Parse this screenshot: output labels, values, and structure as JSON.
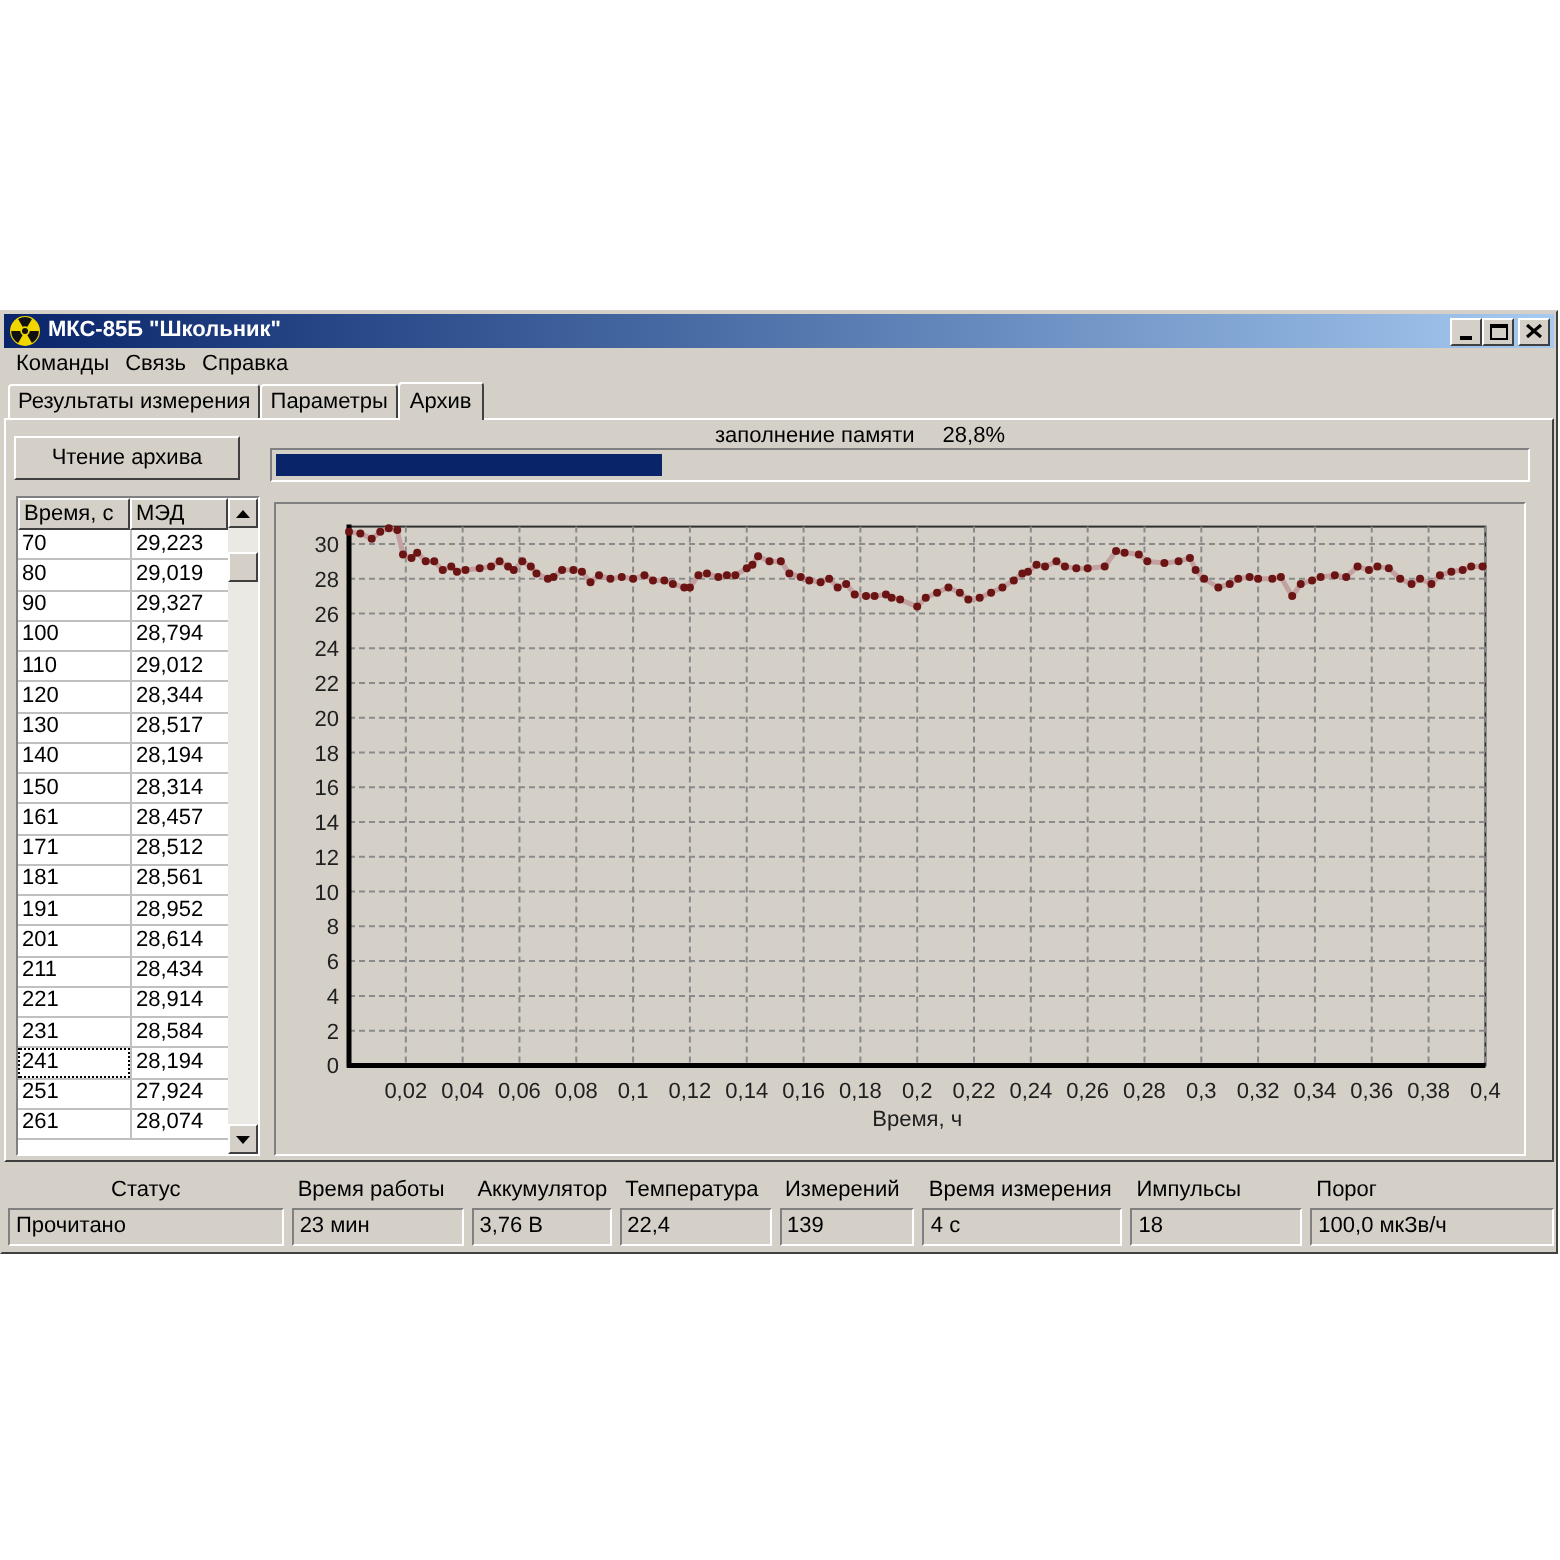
{
  "window": {
    "title": "МКС-85Б \"Школьник\""
  },
  "menu": [
    "Команды",
    "Связь",
    "Справка"
  ],
  "tabs": [
    {
      "label": "Результаты измерения",
      "selected": false
    },
    {
      "label": "Параметры",
      "selected": false
    },
    {
      "label": "Архив",
      "selected": true
    }
  ],
  "archive": {
    "read_button": "Чтение архива",
    "memory": {
      "label": "заполнение памяти",
      "reading": "28,8%",
      "level": 0.31
    },
    "table": {
      "columns": [
        "Время, с",
        "МЭД"
      ],
      "rows": [
        {
          "cells": [
            "70",
            "29,223"
          ],
          "selected": false
        },
        {
          "cells": [
            "80",
            "29,019"
          ],
          "selected": false
        },
        {
          "cells": [
            "90",
            "29,327"
          ],
          "selected": false
        },
        {
          "cells": [
            "100",
            "28,794"
          ],
          "selected": false
        },
        {
          "cells": [
            "110",
            "29,012"
          ],
          "selected": false
        },
        {
          "cells": [
            "120",
            "28,344"
          ],
          "selected": false
        },
        {
          "cells": [
            "130",
            "28,517"
          ],
          "selected": false
        },
        {
          "cells": [
            "140",
            "28,194"
          ],
          "selected": false
        },
        {
          "cells": [
            "150",
            "28,314"
          ],
          "selected": false
        },
        {
          "cells": [
            "161",
            "28,457"
          ],
          "selected": false
        },
        {
          "cells": [
            "171",
            "28,512"
          ],
          "selected": false
        },
        {
          "cells": [
            "181",
            "28,561"
          ],
          "selected": false
        },
        {
          "cells": [
            "191",
            "28,952"
          ],
          "selected": false
        },
        {
          "cells": [
            "201",
            "28,614"
          ],
          "selected": false
        },
        {
          "cells": [
            "211",
            "28,434"
          ],
          "selected": false
        },
        {
          "cells": [
            "221",
            "28,914"
          ],
          "selected": false
        },
        {
          "cells": [
            "231",
            "28,584"
          ],
          "selected": false
        },
        {
          "cells": [
            "241",
            "28,194"
          ],
          "selected": true
        },
        {
          "cells": [
            "251",
            "27,924"
          ],
          "selected": false
        },
        {
          "cells": [
            "261",
            "28,074"
          ],
          "selected": false
        }
      ]
    },
    "chart": {
      "chart_data": {
        "type": "line",
        "xlabel": "Время, ч",
        "xlim": [
          0,
          0.4
        ],
        "ylim": [
          0,
          31
        ],
        "grid": true,
        "xticks": [
          {
            "value": 0.02,
            "label": "0,02"
          },
          {
            "value": 0.04,
            "label": "0,04"
          },
          {
            "value": 0.06,
            "label": "0,06"
          },
          {
            "value": 0.08,
            "label": "0,08"
          },
          {
            "value": 0.1,
            "label": "0,1"
          },
          {
            "value": 0.12,
            "label": "0,12"
          },
          {
            "value": 0.14,
            "label": "0,14"
          },
          {
            "value": 0.16,
            "label": "0,16"
          },
          {
            "value": 0.18,
            "label": "0,18"
          },
          {
            "value": 0.2,
            "label": "0,2"
          },
          {
            "value": 0.22,
            "label": "0,22"
          },
          {
            "value": 0.24,
            "label": "0,24"
          },
          {
            "value": 0.26,
            "label": "0,26"
          },
          {
            "value": 0.28,
            "label": "0,28"
          },
          {
            "value": 0.3,
            "label": "0,3"
          },
          {
            "value": 0.32,
            "label": "0,32"
          },
          {
            "value": 0.34,
            "label": "0,34"
          },
          {
            "value": 0.36,
            "label": "0,36"
          },
          {
            "value": 0.38,
            "label": "0,38"
          },
          {
            "value": 0.4,
            "label": "0,4"
          }
        ],
        "yticks": [
          0,
          2,
          4,
          6,
          8,
          10,
          12,
          14,
          16,
          18,
          20,
          22,
          24,
          26,
          28,
          30
        ],
        "x": [
          0,
          0.004,
          0.008,
          0.011,
          0.014,
          0.017,
          0.019,
          0.022,
          0.024,
          0.027,
          0.03,
          0.033,
          0.036,
          0.038,
          0.041,
          0.046,
          0.05,
          0.053,
          0.056,
          0.058,
          0.061,
          0.064,
          0.066,
          0.07,
          0.072,
          0.075,
          0.079,
          0.082,
          0.085,
          0.088,
          0.092,
          0.096,
          0.1,
          0.104,
          0.107,
          0.111,
          0.114,
          0.118,
          0.12,
          0.123,
          0.126,
          0.13,
          0.133,
          0.136,
          0.14,
          0.142,
          0.144,
          0.148,
          0.152,
          0.155,
          0.159,
          0.162,
          0.166,
          0.169,
          0.172,
          0.175,
          0.178,
          0.182,
          0.185,
          0.189,
          0.191,
          0.194,
          0.2,
          0.203,
          0.207,
          0.211,
          0.215,
          0.218,
          0.222,
          0.226,
          0.23,
          0.234,
          0.237,
          0.239,
          0.242,
          0.245,
          0.249,
          0.252,
          0.256,
          0.26,
          0.266,
          0.27,
          0.273,
          0.278,
          0.281,
          0.287,
          0.292,
          0.296,
          0.298,
          0.301,
          0.306,
          0.31,
          0.313,
          0.317,
          0.32,
          0.325,
          0.328,
          0.332,
          0.335,
          0.339,
          0.342,
          0.347,
          0.351,
          0.355,
          0.359,
          0.362,
          0.366,
          0.37,
          0.374,
          0.377,
          0.381,
          0.384,
          0.388,
          0.392,
          0.395,
          0.399
        ],
        "series": [
          {
            "color": "#6b1414",
            "marker": true,
            "values": [
              30.7,
              30.6,
              30.3,
              30.7,
              30.9,
              30.8,
              29.4,
              29.2,
              29.5,
              29.0,
              29.0,
              28.5,
              28.7,
              28.4,
              28.5,
              28.6,
              28.7,
              29.0,
              28.7,
              28.5,
              29.0,
              28.7,
              28.3,
              28.0,
              28.1,
              28.5,
              28.5,
              28.4,
              27.8,
              28.2,
              28.0,
              28.1,
              28.0,
              28.2,
              27.9,
              27.9,
              27.7,
              27.5,
              27.5,
              28.2,
              28.3,
              28.1,
              28.2,
              28.2,
              28.6,
              28.8,
              29.3,
              29.0,
              29.0,
              28.3,
              28.1,
              27.9,
              27.8,
              28.0,
              27.5,
              27.7,
              27.1,
              27.0,
              27.0,
              27.1,
              26.9,
              26.8,
              26.4,
              26.9,
              27.2,
              27.5,
              27.2,
              26.8,
              26.9,
              27.2,
              27.5,
              27.9,
              28.3,
              28.4,
              28.8,
              28.7,
              29.0,
              28.7,
              28.6,
              28.6,
              28.7,
              29.6,
              29.5,
              29.4,
              29.0,
              28.9,
              29.0,
              29.2,
              28.5,
              28.0,
              27.5,
              27.7,
              28.0,
              28.1,
              28.0,
              28.0,
              28.1,
              27.0,
              27.7,
              27.9,
              28.1,
              28.2,
              28.1,
              28.7,
              28.5,
              28.7,
              28.6,
              28.0,
              27.7,
              28.0,
              27.7,
              28.2,
              28.4,
              28.5,
              28.7,
              28.7
            ]
          }
        ]
      }
    }
  },
  "status_bar": {
    "columns": [
      {
        "header": "Статус",
        "value": "Прочитано"
      },
      {
        "header": "Время работы",
        "value": "23 мин"
      },
      {
        "header": "Аккумулятор",
        "value": "3,76 В"
      },
      {
        "header": "Температура",
        "value": "22,4"
      },
      {
        "header": "Измерений",
        "value": "139"
      },
      {
        "header": "Время измерения",
        "value": "4 с"
      },
      {
        "header": "Импульсы",
        "value": "18"
      },
      {
        "header": "Порог",
        "value": "100,0 мкЗв/ч"
      }
    ]
  }
}
